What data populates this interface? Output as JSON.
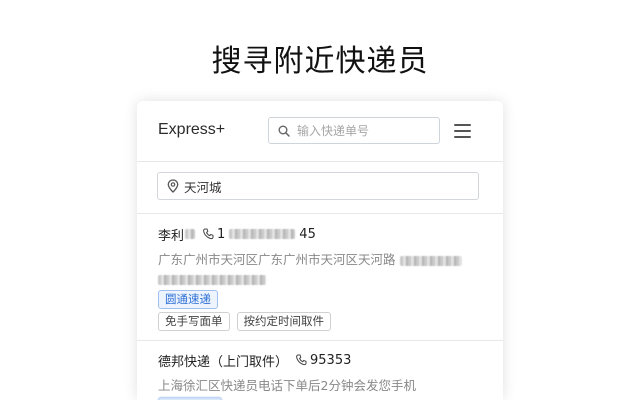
{
  "headline": "搜寻附近快递员",
  "header": {
    "brand": "Express+",
    "search_placeholder": "输入快递单号"
  },
  "location": {
    "value": "天河城"
  },
  "couriers": [
    {
      "name": "李利",
      "phone_prefix": "1",
      "phone_suffix": "45",
      "address": "广东广州市天河区广东广州市天河区天河路",
      "company_tag": "圆通速递",
      "service_tags": [
        "免手写面单",
        "按约定时间取件"
      ]
    },
    {
      "name": "德邦快递（上门取件）",
      "phone": "95353",
      "address": "上海徐汇区快递员电话下单后2分钟会发您手机"
    }
  ],
  "colors": {
    "accent": "#2d6fd6",
    "muted": "#888888",
    "border": "#d3d7dc"
  }
}
